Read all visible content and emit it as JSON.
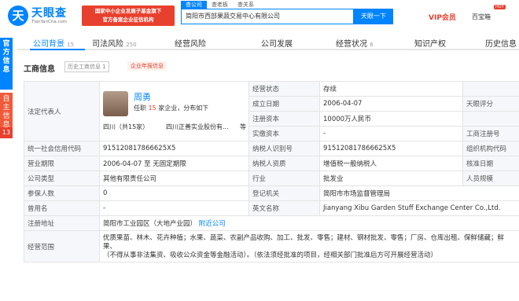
{
  "header": {
    "logo_mark": "天",
    "logo_text": "天眼查",
    "logo_sub": "TianYanCha.com",
    "gov_badge_line1": "国家中小企业发展子基金旗下",
    "gov_badge_line2": "官方备案企业征信机构",
    "search_tabs": [
      "查公司",
      "查老板",
      "查关系"
    ],
    "search_value": "简阳市西部果蔬交易中心有限公司",
    "search_button": "天眼一下",
    "vip_label": "VIP会员",
    "user_label": "百宝箱",
    "hot_badge": "HOT"
  },
  "side_tabs": {
    "tab1": "官方信息",
    "tab2": "自主信息",
    "count": "13"
  },
  "nav": {
    "items": [
      {
        "label": "公司背景",
        "count": "15"
      },
      {
        "label": "司法风险",
        "count": "250"
      },
      {
        "label": "经营风险",
        "count": ""
      },
      {
        "label": "公司发展",
        "count": ""
      },
      {
        "label": "经营状况",
        "count": "6"
      },
      {
        "label": "知识产权",
        "count": ""
      },
      {
        "label": "历史信息",
        "count": ""
      }
    ]
  },
  "section": {
    "title": "工商信息",
    "history": "历史工商信息 1",
    "tag": "企业年报信息"
  },
  "legal": {
    "label": "法定代表人",
    "name": "周勇",
    "line_prefix": "任职",
    "count": "15",
    "line_suffix": "家企业，分布如下",
    "region": "四川（共15家）",
    "company": "四川正善实业股份有...",
    "etc": "等"
  },
  "rows": {
    "status_label": "经营状态",
    "status_value": "存续",
    "found_label": "成立日期",
    "found_value": "2006-04-07",
    "rating_label": "天眼评分",
    "capital_label": "注册资本",
    "capital_value": "10000万人民币",
    "paid_label": "实缴资本",
    "paid_value": "-",
    "reg_no_label": "工商注册号",
    "credit_label": "统一社会信用代码",
    "credit_value": "915120817866625X5",
    "taxid_label": "纳税人识别号",
    "taxid_value": "915120817866625X5",
    "org_label": "组织机构代码",
    "term_label": "营业期限",
    "term_value": "2006-04-07 至 无固定期限",
    "taxtype_label": "纳税人资质",
    "taxtype_value": "增值税一般纳税人",
    "approve_label": "核准日期",
    "type_label": "公司类型",
    "type_value": "其他有限责任公司",
    "industry_label": "行业",
    "industry_value": "批发业",
    "size_label": "人员规模",
    "insured_label": "参保人数",
    "insured_value": "0",
    "authority_label": "登记机关",
    "authority_value": "简阳市市场监督管理局",
    "former_label": "曾用名",
    "former_value": "-",
    "en_label": "英文名称",
    "en_value": "Jianyang Xibu Garden Stuff Exchange Center Co.,Ltd.",
    "addr_label": "注册地址",
    "addr_value": "简阳市工业园区（大地产业园）",
    "addr_link": "附近公司",
    "scope_label": "经营范围",
    "scope_line1": "优质果苗、林木、花卉种植；水果、蔬菜、农副产品收购、加工、批发、零售；建材、钢材批发、零售；厂房、仓库出租、保鲜储藏；鲜果、",
    "scope_line2": "（不得从事非法集资、吸收公众资金等金融活动）。（依法须经批准的项目，经相关部门批准后方可开展经营活动）"
  }
}
